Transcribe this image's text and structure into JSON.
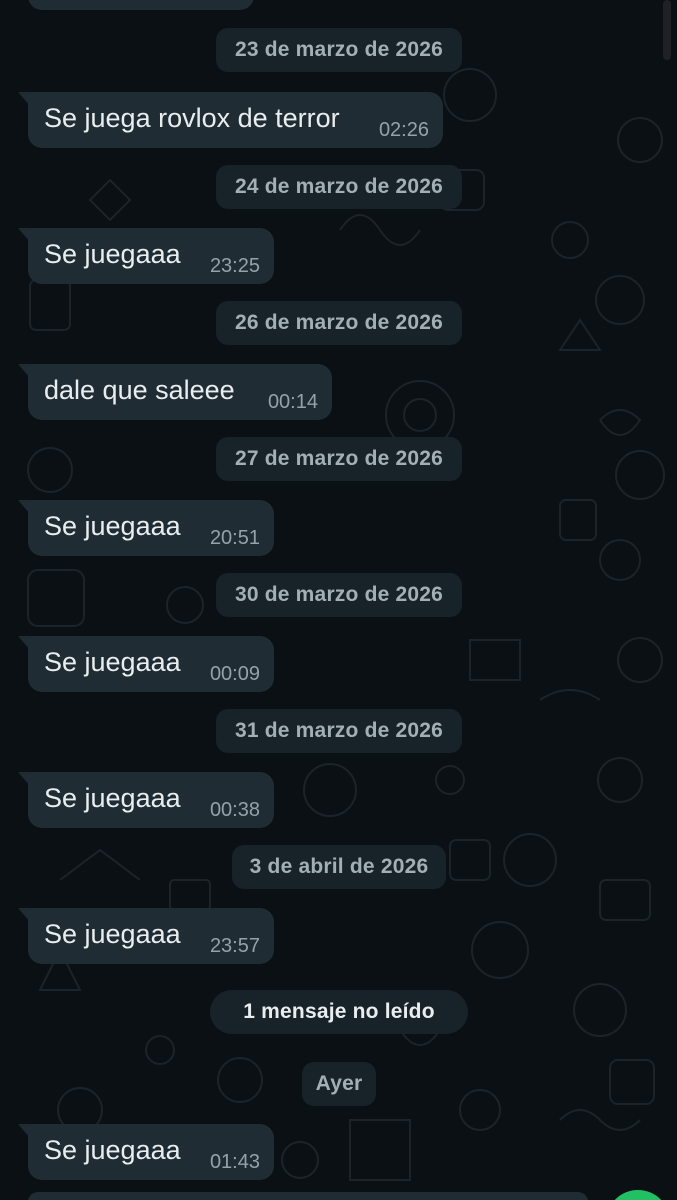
{
  "colors": {
    "background": "#0b1014",
    "bubble_incoming": "#1f2c33",
    "date_chip": "#182229",
    "text_primary": "#e9edef",
    "text_secondary": "#a3afb6",
    "accent_green": "#21c063"
  },
  "messages": [
    {
      "date": "23 de marzo de 2026",
      "text": "Se juega rovlox de terror",
      "time": "02:26"
    },
    {
      "date": "24 de marzo de 2026",
      "text": "Se juegaaa",
      "time": "23:25"
    },
    {
      "date": "26 de marzo de 2026",
      "text": "dale que saleee",
      "time": "00:14"
    },
    {
      "date": "27 de marzo de 2026",
      "text": "Se juegaaa",
      "time": "20:51"
    },
    {
      "date": "30 de marzo de 2026",
      "text": "Se juegaaa",
      "time": "00:09"
    },
    {
      "date": "31 de marzo de 2026",
      "text": "Se juegaaa",
      "time": "00:38"
    },
    {
      "date": "3 de abril de 2026",
      "text": "Se juegaaa",
      "time": "23:57"
    },
    {
      "date": "Ayer",
      "text": "Se juegaaa",
      "time": "01:43"
    }
  ],
  "unread_banner": "1 mensaje no leído",
  "icons": {
    "wallpaper": "doodle-pattern-icon",
    "fab": "green-action-button-icon"
  }
}
